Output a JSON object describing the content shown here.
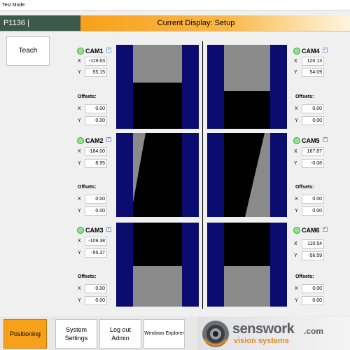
{
  "window": {
    "title": "Test Mode"
  },
  "header": {
    "id_text": "P1136 |",
    "display_title": "Current Display: Setup"
  },
  "teach_label": "Teach",
  "offsets_label": "Offsets:",
  "axis_labels": {
    "x": "X",
    "y": "Y"
  },
  "checkbox_mark": "✓",
  "status_color": "#8ee58e",
  "cameras": [
    {
      "name": "CAM1",
      "x": "-119.63",
      "y": "55.15",
      "off_x": "0.00",
      "off_y": "0.00"
    },
    {
      "name": "CAM2",
      "x": "-184.00",
      "y": "8.95",
      "off_x": "0.00",
      "off_y": "0.00"
    },
    {
      "name": "CAM3",
      "x": "-109.38",
      "y": "-55.37",
      "off_x": "0.00",
      "off_y": "0.00"
    },
    {
      "name": "CAM4",
      "x": "120.13",
      "y": "54.09",
      "off_x": "0.00",
      "off_y": "0.00"
    },
    {
      "name": "CAM5",
      "x": "167.87",
      "y": "-0.08",
      "off_x": "0.00",
      "off_y": "0.00"
    },
    {
      "name": "CAM6",
      "x": "110.54",
      "y": "-56.59",
      "off_x": "0.00",
      "off_y": "0.00"
    }
  ],
  "bottom_buttons": {
    "positioning": "Positioning",
    "system_settings_1": "System",
    "system_settings_2": "Settings",
    "logout_1": "Log out",
    "logout_2": "Admin",
    "windows_explorer": "Windows Explorer"
  },
  "logo": {
    "word": "senswork",
    "com": ".com",
    "tagline": "vision systems"
  },
  "colors": {
    "accent": "#f7a11b",
    "header_dark": "#3c5a4b",
    "view_blue": "#0b0c70",
    "logo_orange": "#e8891a"
  },
  "icons": [
    "checkbox-icon",
    "status-led-icon",
    "camera-lens-logo-icon"
  ]
}
